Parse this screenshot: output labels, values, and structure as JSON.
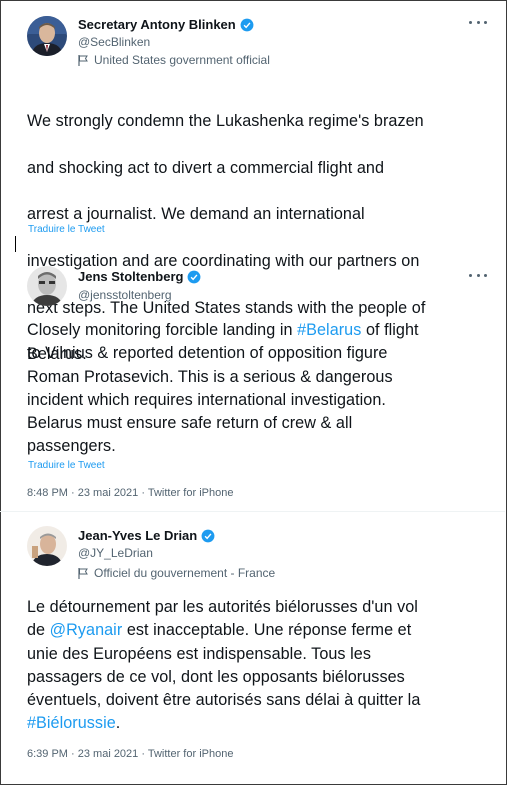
{
  "tweets": [
    {
      "name": "Secretary Antony Blinken",
      "handle": "@SecBlinken",
      "affiliation": "United States government official",
      "body_lines": [
        "We strongly condemn the Lukashenka regime's brazen",
        "and shocking act to divert a commercial flight and",
        "arrest a journalist. We demand an international",
        "investigation and are coordinating with our partners on",
        "next steps. The United States stands with the people of",
        "Belarus."
      ],
      "translate": "Traduire le Tweet"
    },
    {
      "name": "Jens Stoltenberg",
      "handle": "@jensstoltenberg",
      "body_segments": [
        {
          "text": "Closely monitoring forcible landing in ",
          "link": false
        },
        {
          "text": "#Belarus",
          "link": true
        },
        {
          "text": " of flight\nto Vilnius & reported detention of opposition figure\nRoman Protasevich. This is a serious & dangerous\nincident which requires international investigation.\nBelarus must ensure safe return of crew & all\npassengers.",
          "link": false
        }
      ],
      "translate": "Traduire le Tweet",
      "timestamp": "8:48 PM · 23 mai 2021 · Twitter for iPhone"
    },
    {
      "name": "Jean-Yves Le Drian",
      "handle": "@JY_LeDrian",
      "affiliation": "Officiel du gouvernement - France",
      "body_segments": [
        {
          "text": "Le détournement par les autorités biélorusses d'un vol\nde ",
          "link": false
        },
        {
          "text": "@Ryanair",
          "link": true
        },
        {
          "text": " est inacceptable. Une réponse ferme et\nunie des Européens est indispensable. Tous les\npassagers de ce vol, dont les opposants biélorusses\néventuels, doivent être autorisés sans délai à quitter la\n",
          "link": false
        },
        {
          "text": "#Biélorussie",
          "link": true
        },
        {
          "text": ".",
          "link": false
        }
      ],
      "timestamp": "6:39 PM · 23 mai 2021 · Twitter for iPhone"
    }
  ],
  "colors": {
    "link": "#1d9bf0",
    "verified": "#1d9bf0",
    "secondary_text": "#536471"
  },
  "icons": [
    "verified-badge-icon",
    "government-flag-icon",
    "more-options-icon"
  ]
}
